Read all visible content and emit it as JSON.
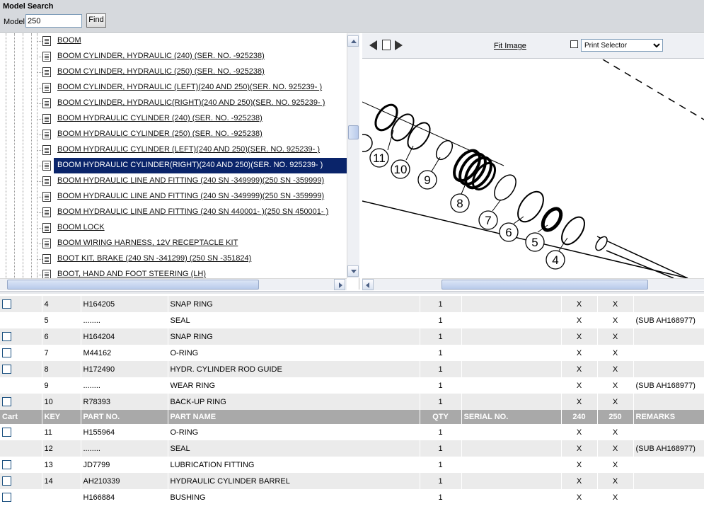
{
  "search": {
    "title": "Model Search",
    "model_label": "Model",
    "model_value": "250",
    "find_label": "Find"
  },
  "tree": {
    "items": [
      {
        "label": "BOOM"
      },
      {
        "label": "BOOM CYLINDER, HYDRAULIC (240) (SER. NO. -925238)"
      },
      {
        "label": "BOOM CYLINDER, HYDRAULIC (250) (SER. NO. -925238)"
      },
      {
        "label": "BOOM CYLINDER, HYDRAULIC (LEFT)(240 AND 250)(SER. NO. 925239- )"
      },
      {
        "label": "BOOM CYLINDER, HYDRAULIC(RIGHT)(240 AND 250)(SER. NO. 925239- )"
      },
      {
        "label": "BOOM HYDRAULIC CYLINDER (240) (SER. NO. -925238)"
      },
      {
        "label": "BOOM HYDRAULIC CYLINDER (250) (SER. NO. -925238)"
      },
      {
        "label": "BOOM HYDRAULIC CYLINDER (LEFT)(240 AND 250)(SER. NO. 925239- )"
      },
      {
        "label": "BOOM HYDRAULIC CYLINDER(RIGHT)(240 AND 250)(SER. NO. 925239- )",
        "selected": true
      },
      {
        "label": "BOOM HYDRAULIC LINE AND FITTING (240 SN -349999)(250 SN -359999)"
      },
      {
        "label": "BOOM HYDRAULIC LINE AND FITTING (240 SN -349999)(250 SN -359999)"
      },
      {
        "label": "BOOM HYDRAULIC LINE AND FITTING (240 SN 440001- )(250 SN 450001- )"
      },
      {
        "label": "BOOM LOCK"
      },
      {
        "label": "BOOM WIRING HARNESS, 12V RECEPTACLE KIT"
      },
      {
        "label": "BOOT KIT, BRAKE (240 SN -341299) (250 SN -351824)"
      },
      {
        "label": "BOOT, HAND AND FOOT STEERING (LH)"
      }
    ]
  },
  "image_toolbar": {
    "fit_label": "Fit Image",
    "print_selector": "Print Selector"
  },
  "diagram": {
    "callouts": [
      "11",
      "10",
      "9",
      "8",
      "7",
      "6",
      "5",
      "4"
    ]
  },
  "table": {
    "headers": [
      "Cart",
      "KEY",
      "PART NO.",
      "PART NAME",
      "QTY",
      "SERIAL NO.",
      "240",
      "250",
      "REMARKS"
    ],
    "rows_top": [
      {
        "cart": true,
        "key": "4",
        "part": "H164205",
        "name": "SNAP RING",
        "qty": "1",
        "serial": "",
        "c240": "X",
        "c250": "X",
        "remarks": ""
      },
      {
        "cart": false,
        "key": "5",
        "part": "........",
        "name": "SEAL",
        "qty": "1",
        "serial": "",
        "c240": "X",
        "c250": "X",
        "remarks": "(SUB AH168977)"
      },
      {
        "cart": true,
        "key": "6",
        "part": "H164204",
        "name": "SNAP RING",
        "qty": "1",
        "serial": "",
        "c240": "X",
        "c250": "X",
        "remarks": ""
      },
      {
        "cart": true,
        "key": "7",
        "part": "M44162",
        "name": "O-RING",
        "qty": "1",
        "serial": "",
        "c240": "X",
        "c250": "X",
        "remarks": ""
      },
      {
        "cart": true,
        "key": "8",
        "part": "H172490",
        "name": "HYDR. CYLINDER ROD GUIDE",
        "qty": "1",
        "serial": "",
        "c240": "X",
        "c250": "X",
        "remarks": ""
      },
      {
        "cart": false,
        "key": "9",
        "part": "........",
        "name": "WEAR RING",
        "qty": "1",
        "serial": "",
        "c240": "X",
        "c250": "X",
        "remarks": "(SUB AH168977)"
      },
      {
        "cart": true,
        "key": "10",
        "part": "R78393",
        "name": "BACK-UP RING",
        "qty": "1",
        "serial": "",
        "c240": "X",
        "c250": "X",
        "remarks": ""
      }
    ],
    "rows_bottom": [
      {
        "cart": true,
        "key": "11",
        "part": "H155964",
        "name": "O-RING",
        "qty": "1",
        "serial": "",
        "c240": "X",
        "c250": "X",
        "remarks": ""
      },
      {
        "cart": false,
        "key": "12",
        "part": "........",
        "name": "SEAL",
        "qty": "1",
        "serial": "",
        "c240": "X",
        "c250": "X",
        "remarks": "(SUB AH168977)"
      },
      {
        "cart": true,
        "key": "13",
        "part": "JD7799",
        "name": "LUBRICATION FITTING",
        "qty": "1",
        "serial": "",
        "c240": "X",
        "c250": "X",
        "remarks": ""
      },
      {
        "cart": true,
        "key": "14",
        "part": "AH210339",
        "name": "HYDRAULIC CYLINDER BARREL",
        "qty": "1",
        "serial": "",
        "c240": "X",
        "c250": "X",
        "remarks": ""
      },
      {
        "cart": true,
        "key": "",
        "part": "H166884",
        "name": "BUSHING",
        "qty": "1",
        "serial": "",
        "c240": "X",
        "c250": "X",
        "remarks": ""
      }
    ]
  }
}
